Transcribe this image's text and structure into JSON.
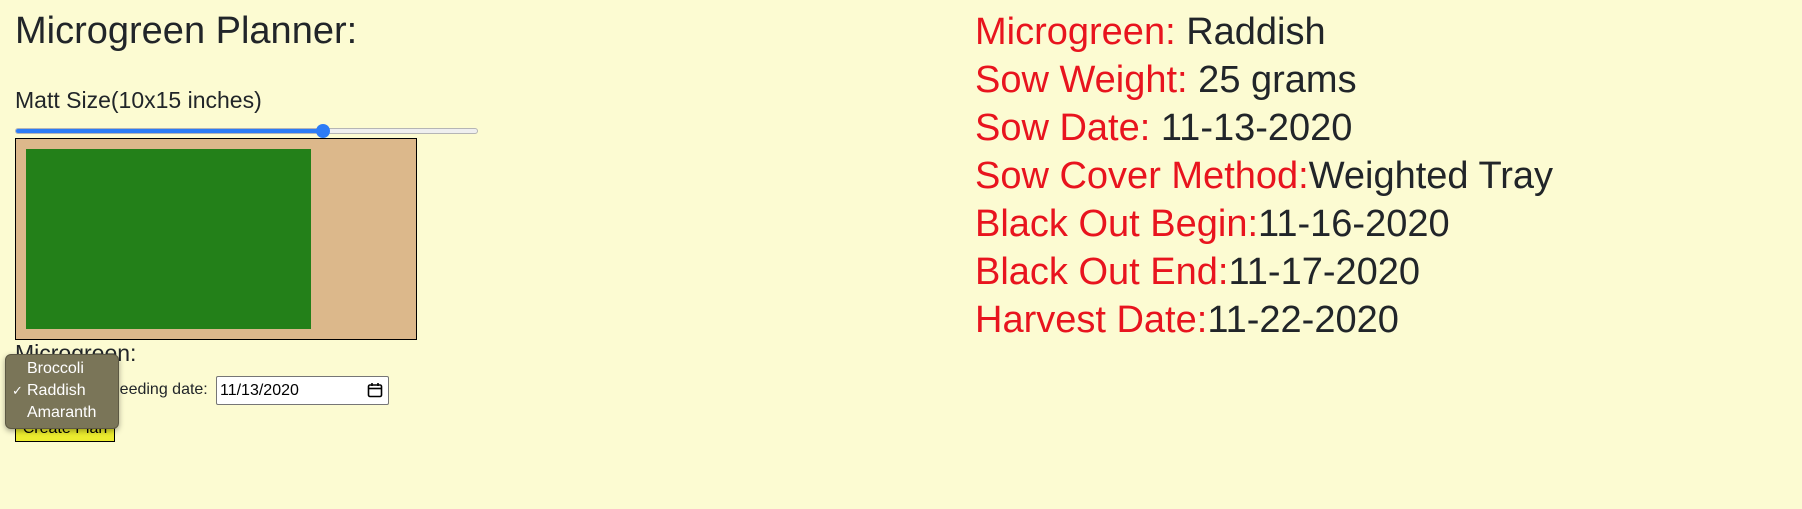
{
  "page_title": "Microgreen Planner:",
  "mat_size": {
    "label": "Matt Size(10x15 inches)",
    "slider_value_percent": 66.5
  },
  "form": {
    "microgreen_label": "Microgreen:",
    "seeding_date_label": "Seeding date:",
    "seeding_date_value": "11/13/2020",
    "create_button_label": "Create Plan",
    "dropdown_options": [
      {
        "label": "Broccoli",
        "selected": false
      },
      {
        "label": "Raddish",
        "selected": true
      },
      {
        "label": "Amaranth",
        "selected": false
      }
    ],
    "check_glyph": "✓"
  },
  "plan": {
    "rows": [
      {
        "label": "Microgreen:",
        "value": " Raddish"
      },
      {
        "label": "Sow Weight:",
        "value": " 25 grams"
      },
      {
        "label": "Sow Date:",
        "value": " 11-13-2020"
      },
      {
        "label": "Sow Cover Method:",
        "value": "Weighted Tray"
      },
      {
        "label": "Black Out Begin:",
        "value": "11-16-2020"
      },
      {
        "label": "Black Out End:",
        "value": "11-17-2020"
      },
      {
        "label": "Harvest Date:",
        "value": "11-22-2020"
      }
    ]
  },
  "colors": {
    "background": "#fcfbd2",
    "mat": "#dcb88b",
    "seed_area": "#238019",
    "label_red": "#e8141e",
    "button_yellow": "#ecec2e",
    "slider_blue": "#2d7cf6"
  }
}
